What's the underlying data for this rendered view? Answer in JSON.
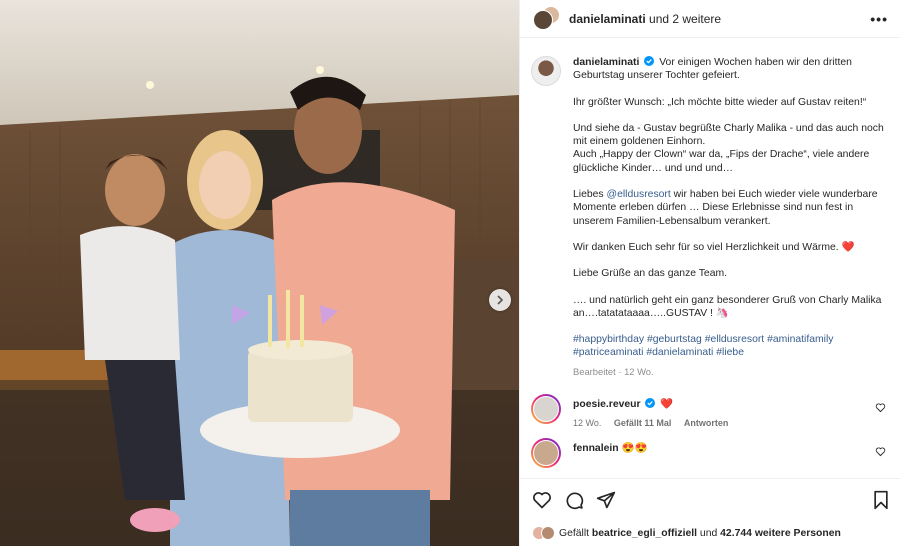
{
  "header": {
    "username": "danielaminati",
    "others": "und 2 weitere",
    "more_label": "•••"
  },
  "caption": {
    "username": "danielaminati",
    "p1": "Vor einigen Wochen haben wir den dritten Geburtstag unserer Tochter gefeiert.",
    "p2": "Ihr größter Wunsch: „Ich möchte bitte wieder auf Gustav reiten!“",
    "p3a": "Und siehe da - Gustav begrüßte Charly Malika - und das auch noch mit einem goldenen Einhorn.",
    "p3b": "Auch „Happy der Clown“ war da, „Fips der Drache“, viele andere glückliche Kinder… und und und…",
    "p4_pre": "Liebes",
    "p4_link": "@elldusresort",
    "p4_post": "wir haben bei Euch wieder viele wunderbare Momente erleben dürfen … Diese Erlebnisse sind nun fest in unserem Familien-Lebensalbum verankert.",
    "p5": "Wir danken Euch sehr für so viel Herzlichkeit und Wärme. ❤️",
    "p6": "Liebe Grüße an das ganze Team.",
    "p7": "…. und natürlich geht ein ganz besonderer Gruß von Charly Malika an….tatatataaaa…..GUSTAV ! 🦄",
    "hashtags": "#happybirthday #geburtstag #elldusresort #aminatifamily #patriceaminati #danielaminati #liebe",
    "edited": "Bearbeitet · 12 Wo."
  },
  "comments": [
    {
      "username": "poesie.reveur",
      "text": "❤️",
      "age": "12 Wo.",
      "likes": "Gefällt 11 Mal",
      "reply": "Antworten"
    },
    {
      "username": "fennalein",
      "text": "😍😍",
      "age": "",
      "likes": "",
      "reply": ""
    }
  ],
  "likes": {
    "prefix": "Gefällt",
    "user": "beatrice_egli_offiziell",
    "mid": "und",
    "count": "42.744 weitere Personen"
  },
  "colors": {
    "link": "#385d8d",
    "verified": "#0095f6",
    "border": "#efefef"
  },
  "icons": [
    "next-arrow-icon",
    "verified-icon",
    "more-icon",
    "heart-icon",
    "comment-icon",
    "share-icon",
    "bookmark-icon"
  ]
}
